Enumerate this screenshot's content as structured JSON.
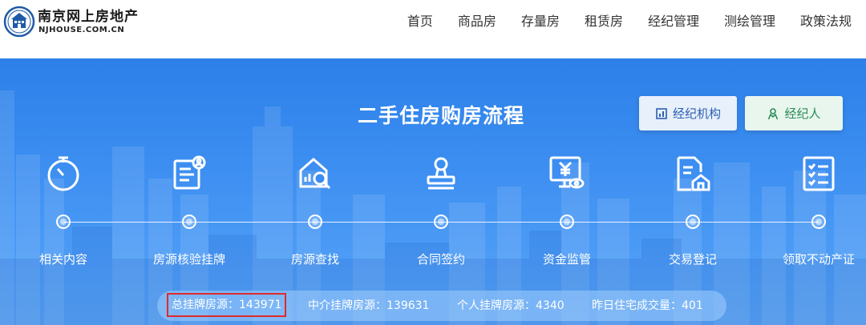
{
  "logo": {
    "cn": "南京网上房地产",
    "en": "NJHOUSE.COM.CN"
  },
  "nav": [
    {
      "label": "首页"
    },
    {
      "label": "商品房"
    },
    {
      "label": "存量房"
    },
    {
      "label": "租赁房"
    },
    {
      "label": "经纪管理"
    },
    {
      "label": "测绘管理"
    },
    {
      "label": "政策法规"
    }
  ],
  "banner": {
    "title": "二手住房购房流程",
    "btn_agency": "经纪机构",
    "btn_agent": "经纪人",
    "steps": [
      {
        "label": "相关内容",
        "icon": "timer-icon"
      },
      {
        "label": "房源核验挂牌",
        "icon": "form-check-icon"
      },
      {
        "label": "房源查找",
        "icon": "house-search-icon"
      },
      {
        "label": "合同签约",
        "icon": "stamp-icon"
      },
      {
        "label": "资金监管",
        "icon": "monitor-yuan-icon"
      },
      {
        "label": "交易登记",
        "icon": "document-house-icon"
      },
      {
        "label": "领取不动产证",
        "icon": "checklist-icon"
      }
    ]
  },
  "stats": {
    "total": "总挂牌房源：143971",
    "agency": "中介挂牌房源：139631",
    "personal": "个人挂牌房源：4340",
    "yesterday": "昨日住宅成交量：401"
  },
  "colors": {
    "banner_blue": "#3a8cf0",
    "highlight_red": "#e02a2a"
  }
}
